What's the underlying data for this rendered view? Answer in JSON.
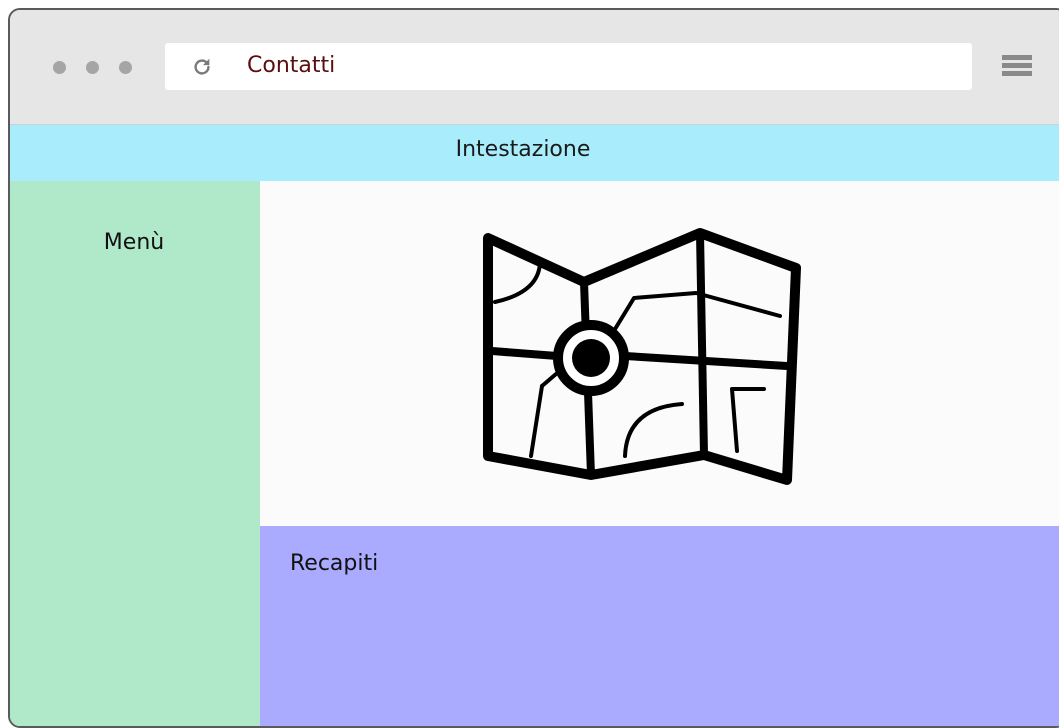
{
  "browser": {
    "address_text": "Contatti",
    "reload_icon": "reload-icon",
    "menu_icon": "hamburger-menu-icon",
    "window_controls": [
      "dot",
      "dot",
      "dot"
    ]
  },
  "page": {
    "header_label": "Intestazione",
    "sidebar_label": "Menù",
    "main_icon": "map-location-icon",
    "footer_label": "Recapiti"
  },
  "colors": {
    "header_bg": "#a9edfd",
    "sidebar_bg": "#b0e9c9",
    "contacts_bg": "#aaaaff",
    "url_text": "#5a0f0f"
  }
}
